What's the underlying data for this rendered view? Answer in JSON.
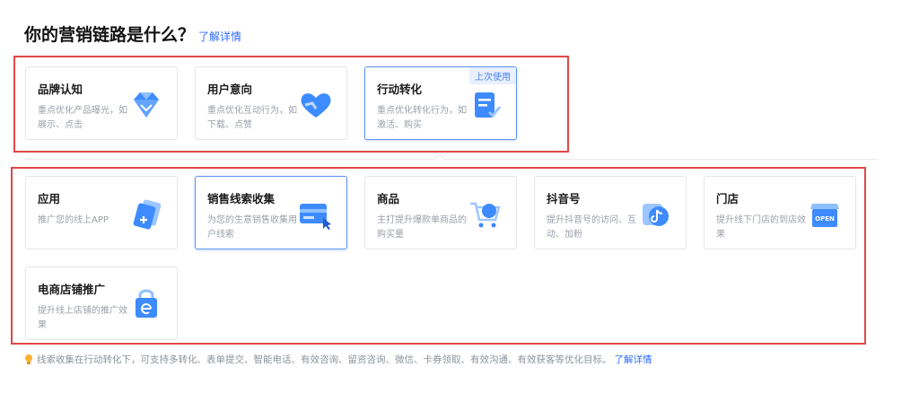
{
  "header": {
    "title": "你的营销链路是什么？",
    "link": "了解详情"
  },
  "group1": [
    {
      "title": "品牌认知",
      "desc": "重点优化产品曝光，如展示、点击",
      "icon": "diamond-icon"
    },
    {
      "title": "用户意向",
      "desc": "重点优化互动行为，如下载、点赞",
      "icon": "heart-icon"
    },
    {
      "title": "行动转化",
      "desc": "重点优化转化行为，如激活、购买",
      "icon": "document-check-icon",
      "badge": "上次使用",
      "active": true
    }
  ],
  "group2": [
    {
      "title": "应用",
      "desc": "推广您的线上APP",
      "icon": "app-card-icon"
    },
    {
      "title": "销售线索收集",
      "desc": "为您的生意销售收集用户线索",
      "icon": "form-cursor-icon",
      "active": true
    },
    {
      "title": "商品",
      "desc": "主打提升爆款单商品的购买量",
      "icon": "shopping-cart-icon"
    },
    {
      "title": "抖音号",
      "desc": "提升抖音号的访问、互动、加粉",
      "icon": "douyin-icon"
    },
    {
      "title": "门店",
      "desc": "提升线下门店的到店效果",
      "icon": "store-open-icon",
      "icon_text": "OPEN"
    },
    {
      "title": "电商店铺推广",
      "desc": "提升线上店铺的推广效果",
      "icon": "shop-bag-icon"
    }
  ],
  "footer": {
    "text": "线索收集在行动转化下，可支持多转化、表单提交、智能电话、有效咨询、留资咨询、微信、卡券领取、有效沟通、有效获客等优化目标。",
    "link": "了解详情"
  },
  "colors": {
    "accent": "#2f6bff",
    "highlight_border": "#e04747",
    "icon_blue": "#3d8bff"
  }
}
